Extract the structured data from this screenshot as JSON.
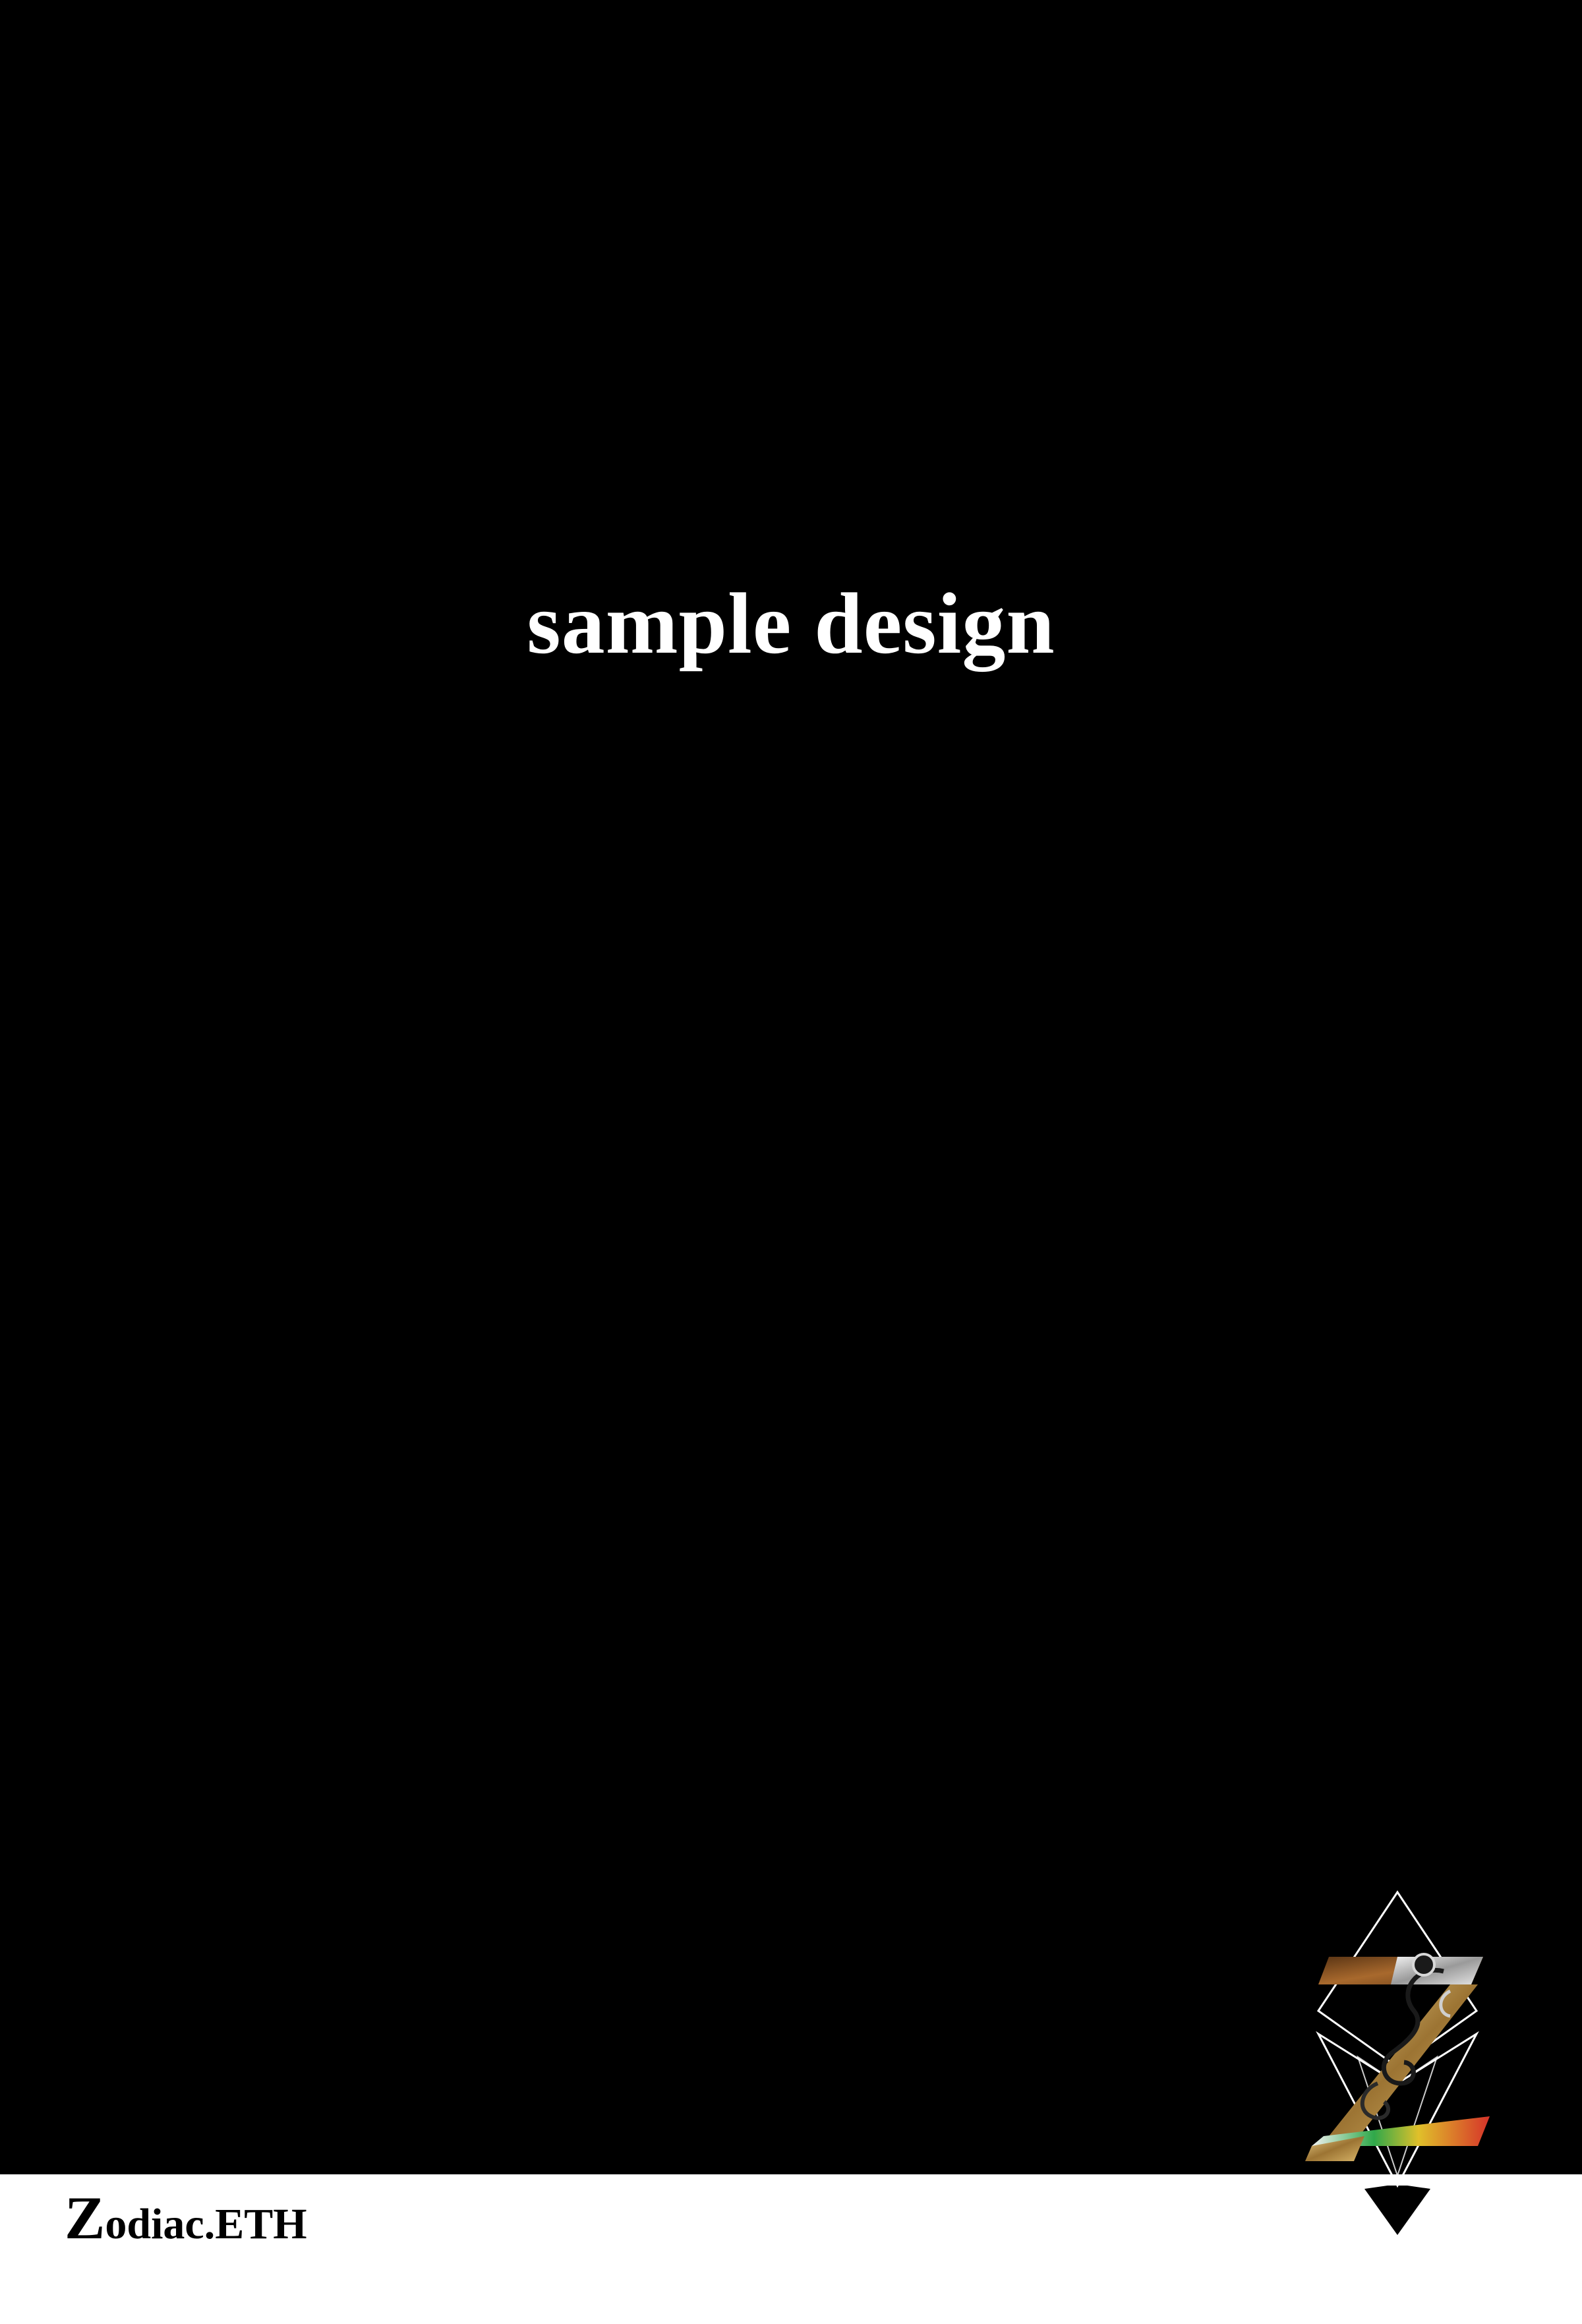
{
  "poster": {
    "headline": "sample design",
    "background_color": "#000000"
  },
  "footer": {
    "brand_initial": "Z",
    "brand_rest": "odiac.ETH",
    "background_color": "#ffffff"
  },
  "emblem": {
    "icon": "zodiac-diamond-logo-icon",
    "accent_colors": [
      "#8a5a2b",
      "#c9a46a",
      "#d8d8d8",
      "#2fa84a",
      "#e0c02a",
      "#d6332a"
    ]
  }
}
